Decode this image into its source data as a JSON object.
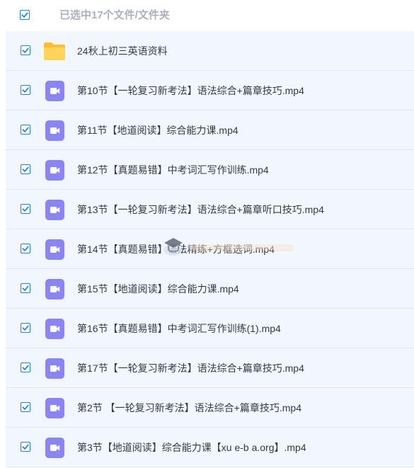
{
  "header": {
    "selection_label": "已选中17个文件/文件夹",
    "checked": true
  },
  "files": [
    {
      "name": "24秋上初三英语资料",
      "type": "folder",
      "icon": "folder-icon",
      "checked": true
    },
    {
      "name": "第10节【一轮复习新考法】语法综合+篇章技巧.mp4",
      "type": "video",
      "icon": "video-icon",
      "checked": true
    },
    {
      "name": "第11节【地道阅读】综合能力课.mp4",
      "type": "video",
      "icon": "video-icon",
      "checked": true
    },
    {
      "name": "第12节【真题易错】中考词汇写作训练.mp4",
      "type": "video",
      "icon": "video-icon",
      "checked": true
    },
    {
      "name": "第13节【一轮复习新考法】语法综合+篇章听口技巧.mp4",
      "type": "video",
      "icon": "video-icon",
      "checked": true
    },
    {
      "name": "第14节【真题易错】语法精练+方框选词.mp4",
      "type": "video",
      "icon": "video-icon",
      "checked": true
    },
    {
      "name": "第15节【地道阅读】综合能力课.mp4",
      "type": "video",
      "icon": "video-icon",
      "checked": true
    },
    {
      "name": "第16节【真题易错】中考词汇写作训练(1).mp4",
      "type": "video",
      "icon": "video-icon",
      "checked": true
    },
    {
      "name": "第17节【一轮复习新考法】语法综合+篇章技巧.mp4",
      "type": "video",
      "icon": "video-icon",
      "checked": true
    },
    {
      "name": "第2节 【一轮复习新考法】语法综合+篇章技巧.mp4",
      "type": "video",
      "icon": "video-icon",
      "checked": true
    },
    {
      "name": "第3节【地道阅读】综合能力课【xu e-b a.org】.mp4",
      "type": "video",
      "icon": "video-icon",
      "checked": true
    }
  ],
  "colors": {
    "checkbox_blue": "#1b7fe0",
    "folder_yellow": "#ffc63a",
    "video_purple": "#8a85f3",
    "row_background": "#f1f7fd"
  }
}
